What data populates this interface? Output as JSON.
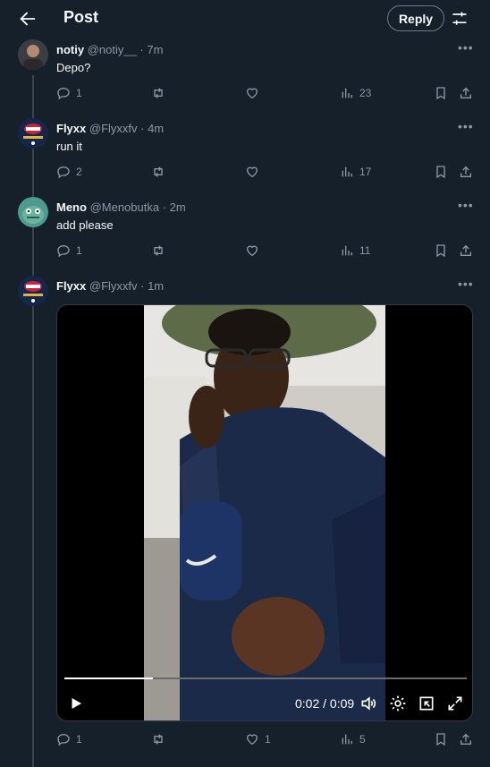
{
  "header": {
    "title": "Post",
    "reply_label": "Reply"
  },
  "tweets": [
    {
      "name": "notiy",
      "handle": "@notiy__",
      "time": "7m",
      "text": "Depo?",
      "replies": "1",
      "likes": "",
      "views": "23"
    },
    {
      "name": "Flyxx",
      "handle": "@Flyxxfv",
      "time": "4m",
      "text": "run it",
      "replies": "2",
      "likes": "",
      "views": "17"
    },
    {
      "name": "Meno",
      "handle": "@Menobutka",
      "time": "2m",
      "text": "add please",
      "replies": "1",
      "likes": "",
      "views": "11"
    },
    {
      "name": "Flyxx",
      "handle": "@Flyxxfv",
      "time": "1m",
      "text": "",
      "replies": "1",
      "likes": "1",
      "views": "5"
    }
  ],
  "video": {
    "current": "0:02",
    "duration": "0:09",
    "progress": 0.22
  },
  "sep": " · ",
  "icons": [
    "back-arrow-icon",
    "tune-icon",
    "more-icon",
    "reply-icon",
    "retweet-icon",
    "like-icon",
    "views-icon",
    "bookmark-icon",
    "share-icon",
    "play-icon",
    "volume-icon",
    "settings-icon",
    "minimize-icon",
    "fullscreen-icon"
  ],
  "colors": {
    "background": "#15202b",
    "text": "#f7f9f9",
    "muted": "#8b98a5"
  }
}
